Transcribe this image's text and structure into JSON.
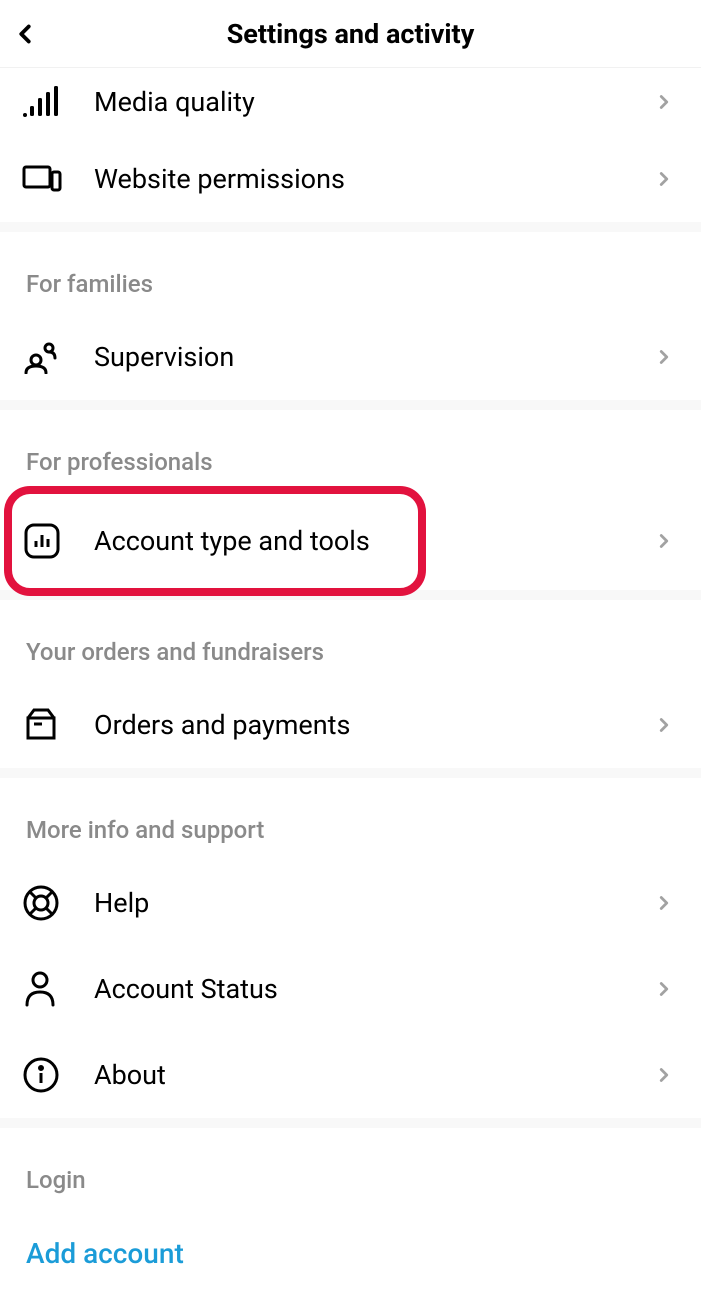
{
  "header": {
    "title": "Settings and activity"
  },
  "top_items": [
    {
      "id": "media-quality",
      "label": "Media quality"
    },
    {
      "id": "website-permissions",
      "label": "Website permissions"
    }
  ],
  "sections": [
    {
      "id": "families",
      "title": "For families",
      "items": [
        {
          "id": "supervision",
          "label": "Supervision"
        }
      ]
    },
    {
      "id": "professionals",
      "title": "For professionals",
      "items": [
        {
          "id": "account-type-tools",
          "label": "Account type and tools",
          "highlight": true
        }
      ]
    },
    {
      "id": "orders",
      "title": "Your orders and fundraisers",
      "items": [
        {
          "id": "orders-payments",
          "label": "Orders and payments"
        }
      ]
    },
    {
      "id": "support",
      "title": "More info and support",
      "items": [
        {
          "id": "help",
          "label": "Help"
        },
        {
          "id": "account-status",
          "label": "Account Status"
        },
        {
          "id": "about",
          "label": "About"
        }
      ]
    },
    {
      "id": "login",
      "title": "Login",
      "items": [],
      "links": [
        {
          "id": "add-account",
          "label": "Add account"
        }
      ]
    }
  ]
}
